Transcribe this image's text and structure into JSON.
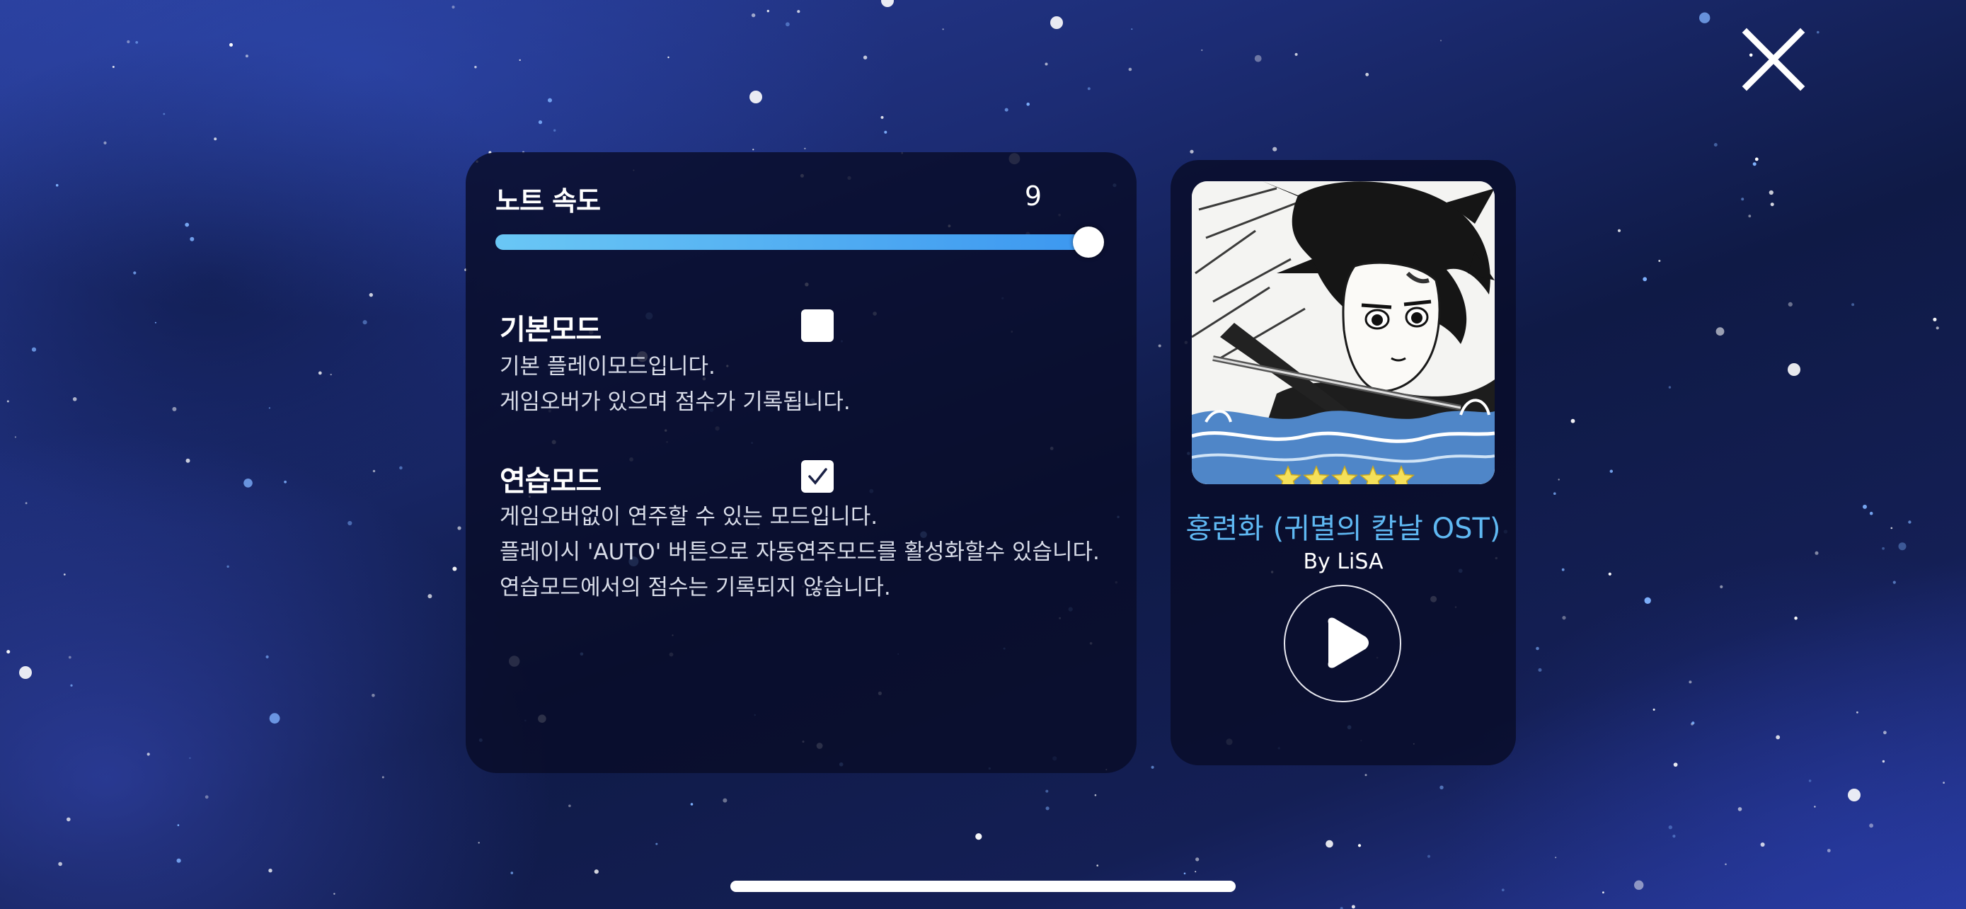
{
  "settings": {
    "note_speed": {
      "label": "노트 속도",
      "value": "9",
      "slider_fraction": 1.0
    },
    "modes": [
      {
        "title": "기본모드",
        "checked": false,
        "description": [
          "기본 플레이모드입니다.",
          "게임오버가 있으며 점수가 기록됩니다."
        ]
      },
      {
        "title": "연습모드",
        "checked": true,
        "description": [
          "게임오버없이 연주할 수 있는 모드입니다.",
          "플레이시 'AUTO' 버튼으로 자동연주모드를 활성화할수 있습니다.",
          "연습모드에서의 점수는 기록되지 않습니다."
        ]
      }
    ]
  },
  "song": {
    "title": "홍련화 (귀멸의 칼날 OST)",
    "artist": "By LiSA",
    "difficulty_stars": 5,
    "album_art_icon": "anime-character-illustration"
  },
  "icons": {
    "close": "close-icon",
    "play": "play-icon",
    "check": "check-icon",
    "star": "star-icon"
  },
  "colors": {
    "accent": "#5fb8f2",
    "slider_start": "#6ac7f5",
    "slider_end": "#3c97f0",
    "star": "#f5e05a",
    "panel": "#080c28"
  }
}
